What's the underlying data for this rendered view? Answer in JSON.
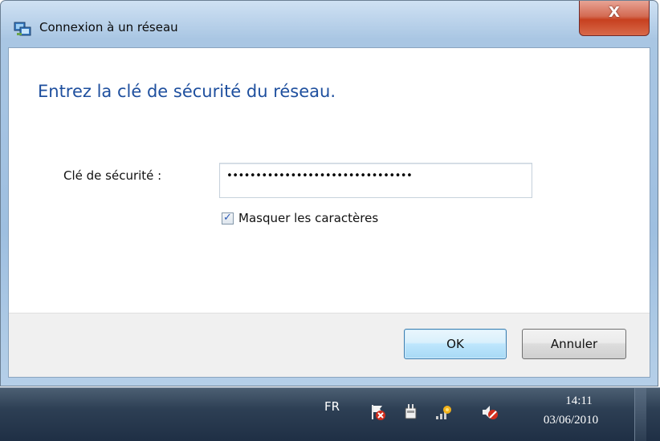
{
  "window": {
    "title": "Connexion à un réseau",
    "close_label": "X"
  },
  "dialog": {
    "heading": "Entrez la clé de sécurité du réseau.",
    "key_label": "Clé de sécurité :",
    "key_masked_value": "••••••••••••••••••••••••••••••••",
    "hide_chars_label": "Masquer les caractères",
    "hide_chars_checked": true,
    "ok_label": "OK",
    "cancel_label": "Annuler"
  },
  "taskbar": {
    "language": "FR",
    "time": "14:11",
    "date": "03/06/2010",
    "tray_icons": [
      "action-center-icon",
      "power-icon",
      "network-icon",
      "volume-muted-icon"
    ]
  },
  "colors": {
    "heading_blue": "#1e4f9e",
    "close_red": "#c7401f",
    "taskbar": "#2d3f54"
  }
}
